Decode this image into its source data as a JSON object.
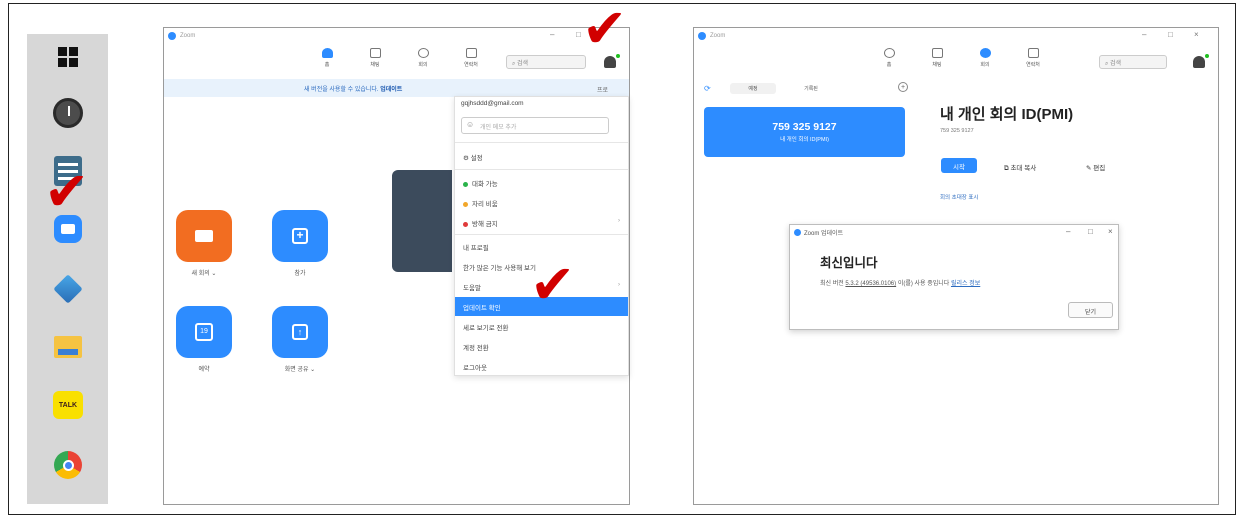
{
  "taskbar": {
    "icons": [
      "windows-start-icon",
      "alarm-clock-icon",
      "list-app-icon",
      "zoom-app-icon",
      "cube-app-icon",
      "folder-icon",
      "kakaotalk-icon",
      "chrome-icon"
    ],
    "talk_label": "TALK"
  },
  "left_window": {
    "title": "Zoom",
    "nav": [
      {
        "label": "홈",
        "icon": "home-icon"
      },
      {
        "label": "채팅",
        "icon": "chat-icon"
      },
      {
        "label": "회의",
        "icon": "clock-icon"
      },
      {
        "label": "연락처",
        "icon": "contacts-icon"
      }
    ],
    "search_placeholder": "검색",
    "banner_text": "새 버전을 사용할 수 있습니다.",
    "banner_link": "업데이트",
    "tiles": [
      {
        "label": "새 회의 ⌄",
        "icon": "video-camera-icon"
      },
      {
        "label": "참가",
        "icon": "plus-icon"
      },
      {
        "label": "예약",
        "icon": "calendar-icon",
        "day": "19"
      },
      {
        "label": "화면 공유 ⌄",
        "icon": "share-up-icon"
      }
    ],
    "menu": {
      "top_right_label": "프로",
      "email": "gqjhsddd@gmail.com",
      "status_placeholder": "개인 메모 추가",
      "settings": "설정",
      "statuses": [
        {
          "label": "대화 가능",
          "color": "#2ab34a"
        },
        {
          "label": "자리 비움",
          "color": "#f2a72b"
        },
        {
          "label": "방해 금지",
          "color": "#e03a3a"
        }
      ],
      "items": [
        "내 프로필",
        "한가 많은 기능 사용해 보기",
        "도움말",
        "업데이트 확인",
        "세로 보기로 전환",
        "계정 전환",
        "로그아웃"
      ],
      "highlighted_index": 3
    }
  },
  "right_window": {
    "title": "Zoom",
    "nav": [
      {
        "label": "홈",
        "icon": "home-icon"
      },
      {
        "label": "채팅",
        "icon": "chat-icon"
      },
      {
        "label": "회의",
        "icon": "clock-icon"
      },
      {
        "label": "연락처",
        "icon": "contacts-icon"
      }
    ],
    "search_placeholder": "검색",
    "subtabs": [
      "예정",
      "기록된"
    ],
    "pmi_number": "759 325 9127",
    "pmi_card_sub": "내 개인 회의 ID(PMI)",
    "pmi_title": "내 개인 회의 ID(PMI)",
    "pmi_sub": "759 325 9127",
    "start": "시작",
    "invite": "초대 복사",
    "edit": "편집",
    "show_invite": "회의 초대장 표시",
    "dialog": {
      "title": "Zoom 업데이트",
      "heading": "최신입니다",
      "body_prefix": "최신 버전",
      "version": "5.3.2 (49536.0106)",
      "body_suffix": "이(를) 사용 중입니다",
      "release_notes": "릴리스 정보",
      "close": "닫기"
    }
  },
  "check_glyph": "✔"
}
